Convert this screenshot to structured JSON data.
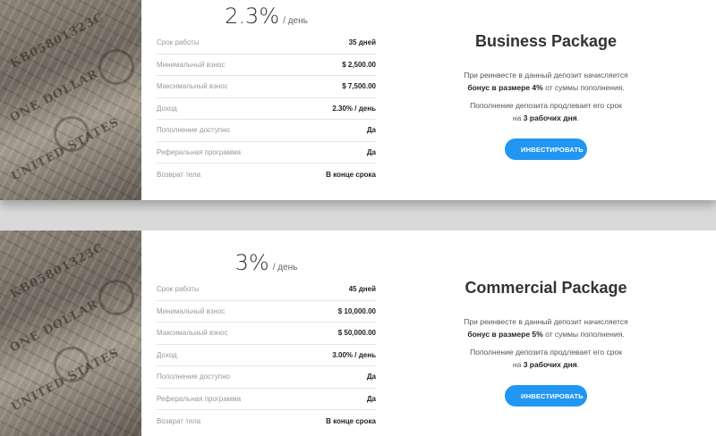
{
  "packages": [
    {
      "rate": "2.3%",
      "rate_unit": "/ день",
      "rows": [
        {
          "label": "Срок работы",
          "value": "35 дней"
        },
        {
          "label": "Минимальный взнос",
          "value": "$ 2,500.00"
        },
        {
          "label": "Максимальный взнос",
          "value": "$ 7,500.00"
        },
        {
          "label": "Доход",
          "value": "2.30% / день"
        },
        {
          "label": "Пополнение доступно",
          "value": "Да"
        },
        {
          "label": "Реферальная программа",
          "value": "Да"
        },
        {
          "label": "Возврат тела",
          "value": "В конце срока"
        }
      ],
      "title": "Business Package",
      "desc1_pre": "При реинвесте в данный депозит начисляется",
      "desc1_bold": "бонус в размере 4%",
      "desc1_post": " от суммы пополнения.",
      "desc2_pre": "Пополнение депозита продлевает его срок",
      "desc2_mid": "на ",
      "desc2_bold": "3 рабочих дня",
      "desc2_post": ".",
      "button": "ИНВЕСТИРОВАТЬ"
    },
    {
      "rate": "3%",
      "rate_unit": "/ день",
      "rows": [
        {
          "label": "Срок работы",
          "value": "45 дней"
        },
        {
          "label": "Минимальный взнос",
          "value": "$ 10,000.00"
        },
        {
          "label": "Максимальный взнос",
          "value": "$ 50,000.00"
        },
        {
          "label": "Доход",
          "value": "3.00% / день"
        },
        {
          "label": "Пополнение доступно",
          "value": "Да"
        },
        {
          "label": "Реферальная программа",
          "value": "Да"
        },
        {
          "label": "Возврат тела",
          "value": "В конце срока"
        }
      ],
      "title": "Commercial Package",
      "desc1_pre": "При реинвесте в данный депозит начисляется",
      "desc1_bold": "бонус в размере 5%",
      "desc1_post": " от суммы пополнения.",
      "desc2_pre": "Пополнение депозита продлевает его срок",
      "desc2_mid": "на ",
      "desc2_bold": "3 рабочих дня",
      "desc2_post": ".",
      "button": "ИНВЕСТИРОВАТЬ"
    }
  ],
  "photo_text": {
    "line1": "KB05801323C",
    "line2": "ONE DOLLAR",
    "line3": "UNITED STATES"
  }
}
